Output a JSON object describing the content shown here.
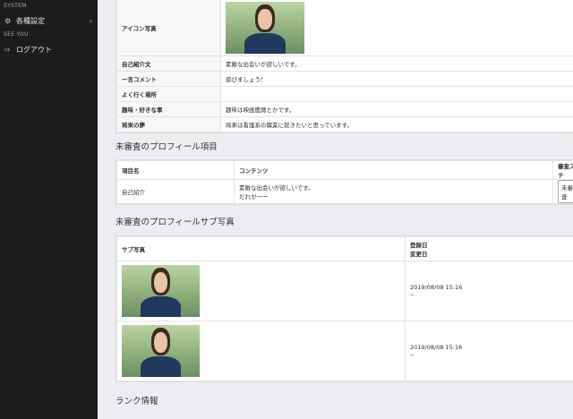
{
  "sidebar": {
    "section1": "SYSTEM",
    "item_settings": "各種設定",
    "section2": "SEE YOU",
    "item_logout": "ログアウト"
  },
  "profile": {
    "icon_label": "アイコン写真",
    "rows": [
      {
        "label": "自己紹介文",
        "value": "素敵な出会いが欲しいです。"
      },
      {
        "label": "一言コメント",
        "value": "遊びましょう！"
      },
      {
        "label": "よく行く場所",
        "value": ""
      },
      {
        "label": "趣味・好きな事",
        "value": "趣味は映画鑑賞とかです。"
      },
      {
        "label": "将来の夢",
        "value": "将来は看護系の職業に就きたいと思っています。"
      }
    ]
  },
  "pending": {
    "title": "未審査のプロフィール項目",
    "col_item": "項目名",
    "col_content": "コンテンツ",
    "col_status": "審査ステ",
    "row_item": "自己紹介",
    "row_content_1": "素敵な出会いが欲しいです。",
    "row_content_2": "だれが一ー",
    "row_button": "未審査"
  },
  "subphotos": {
    "title": "未審査のプロフィールサブ写真",
    "col_photo": "サブ写真",
    "col_date_1": "登録日",
    "col_date_2": "変更日",
    "rows": [
      {
        "registered": "2019/08/08 15:16",
        "changed": "--"
      },
      {
        "registered": "2019/08/08 15:16",
        "changed": "--"
      }
    ]
  },
  "rank": {
    "title": "ランク情報"
  }
}
